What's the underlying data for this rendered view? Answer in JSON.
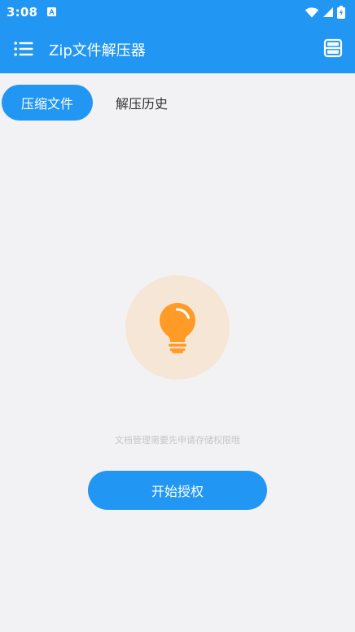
{
  "status_bar": {
    "time": "3:08",
    "notification_icon": "A-icon",
    "icons": [
      "wifi-icon",
      "signal-icon",
      "battery-icon"
    ]
  },
  "app_bar": {
    "title": "Zip文件解压器",
    "left_icon": "menu-icon",
    "right_icon": "layout-icon"
  },
  "tabs": [
    {
      "label": "压缩文件",
      "active": true
    },
    {
      "label": "解压历史",
      "active": false
    }
  ],
  "content": {
    "icon": "lightbulb-icon",
    "permission_message": "文档管理需要先申请存储权限哦",
    "grant_button_label": "开始授权"
  },
  "colors": {
    "primary": "#2196f3",
    "background": "#f2f2f5",
    "bulb_bg": "#f5e6d6",
    "bulb": "#ff9b26"
  }
}
